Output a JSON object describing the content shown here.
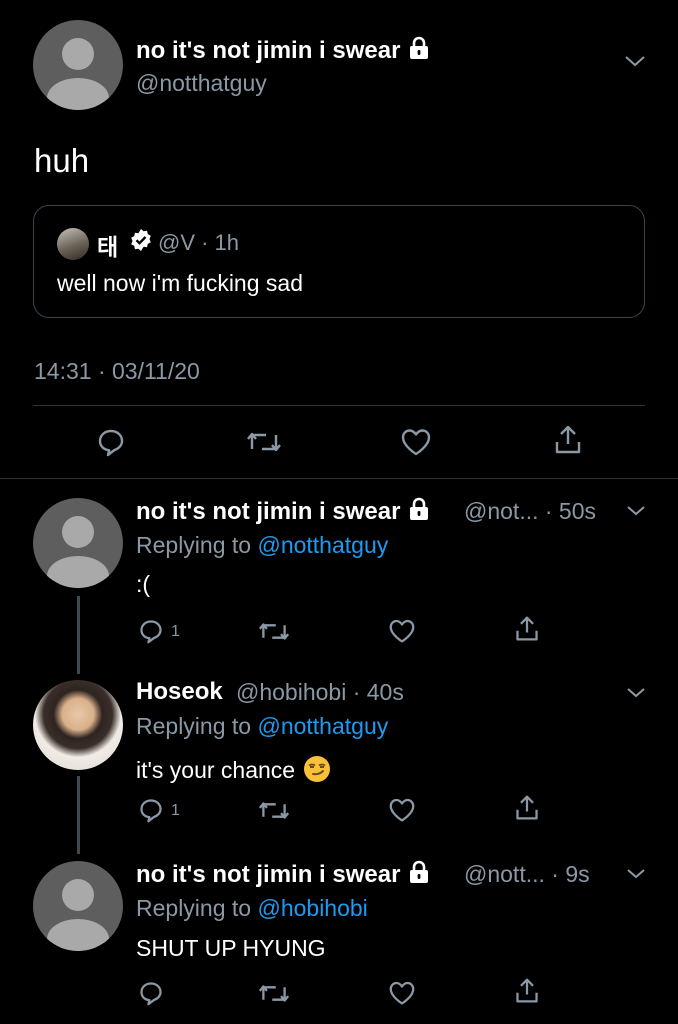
{
  "main_tweet": {
    "author_name": "no it's not jimin i swear",
    "handle": "@notthatguy",
    "text": "huh",
    "timestamp": "14:31 · 03/11/20",
    "quoted": {
      "name": "태",
      "handle_time": "@V · 1h",
      "text": "well now i'm fucking sad"
    }
  },
  "replies": [
    {
      "author_name": "no it's not jimin i swear",
      "handle_time": "@not... · 50s",
      "replying_prefix": "Replying to ",
      "replying_to": "@notthatguy",
      "text": ":(",
      "reply_count": "1"
    },
    {
      "author_name": "Hoseok",
      "handle_time": "@hobihobi · 40s",
      "replying_prefix": "Replying to ",
      "replying_to": "@notthatguy",
      "text": "it's your chance",
      "emoji": "smirk-face",
      "reply_count": "1"
    },
    {
      "author_name": "no it's not jimin i swear",
      "handle_time": "@nott... · 9s",
      "replying_prefix": "Replying to ",
      "replying_to": "@hobihobi",
      "text": "SHUT UP HYUNG",
      "reply_count": ""
    }
  ],
  "colors": {
    "background": "#000000",
    "secondary_text": "#8b98a5",
    "link": "#1d9bf0",
    "verified": "#ffffff"
  },
  "icons": [
    "lock-icon",
    "chevron-down-icon",
    "reply-icon",
    "retweet-icon",
    "like-icon",
    "share-icon",
    "verified-icon"
  ]
}
